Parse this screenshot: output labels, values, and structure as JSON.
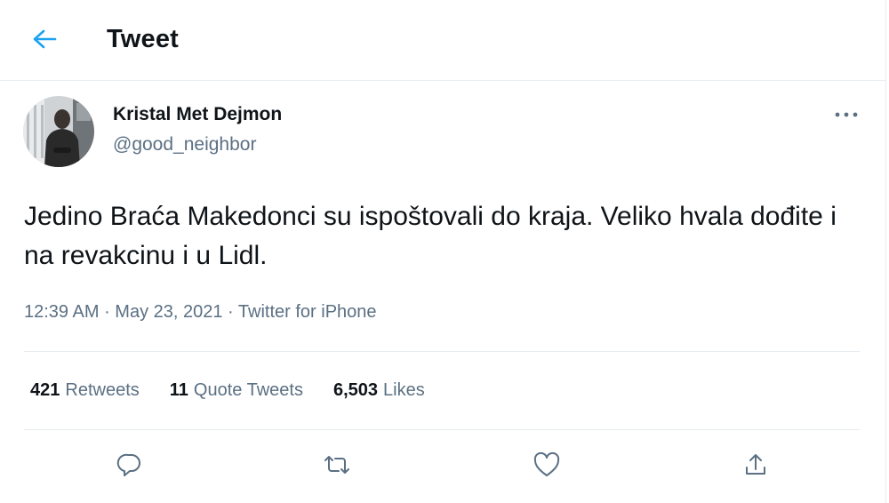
{
  "header": {
    "title": "Tweet",
    "back_icon": "arrow-left-icon"
  },
  "colors": {
    "accent": "#1da1f2",
    "text": "#0f1419",
    "secondary": "#5b7083",
    "border": "#e6ecf0"
  },
  "author": {
    "name": "Kristal Met Dejmon",
    "handle": "@good_neighbor"
  },
  "tweet": {
    "text": "Jedino Braća Makedonci su ispoštovali do kraja. Veliko hvala dođite i na revakcinu i u Lidl.",
    "time": "12:39 AM",
    "separator1": " · ",
    "date": "May 23, 2021",
    "separator2": " · ",
    "source": "Twitter for iPhone"
  },
  "stats": {
    "retweets_count": "421",
    "retweets_label": "Retweets",
    "quotes_count": "11",
    "quotes_label": "Quote Tweets",
    "likes_count": "6,503",
    "likes_label": "Likes"
  },
  "actions": {
    "icons": [
      "reply-icon",
      "retweet-icon",
      "like-icon",
      "share-icon"
    ]
  }
}
